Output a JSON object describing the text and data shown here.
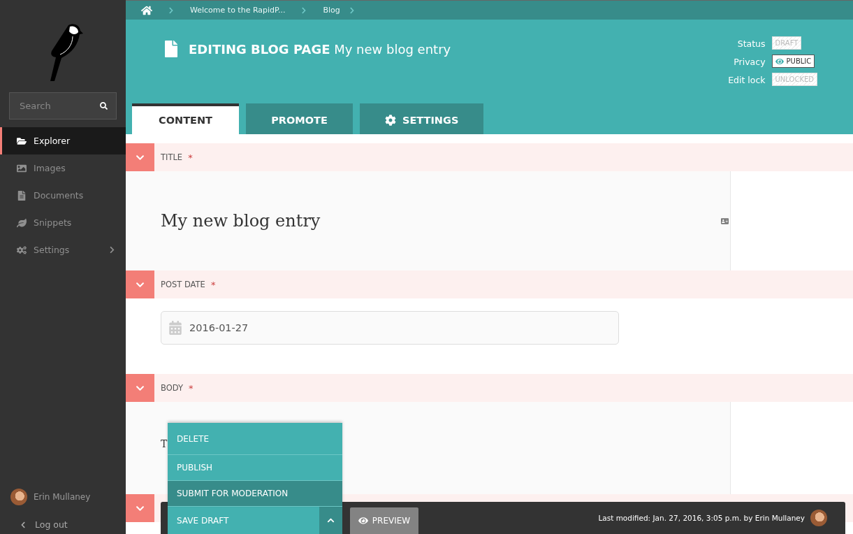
{
  "sidebar": {
    "search": {
      "placeholder": "Search"
    },
    "items": [
      {
        "label": "Explorer",
        "selected": true,
        "has_submenu": false
      },
      {
        "label": "Images",
        "selected": false,
        "has_submenu": false
      },
      {
        "label": "Documents",
        "selected": false,
        "has_submenu": false
      },
      {
        "label": "Snippets",
        "selected": false,
        "has_submenu": false
      },
      {
        "label": "Settings",
        "selected": false,
        "has_submenu": true
      }
    ],
    "user": {
      "name": "Erin Mullaney"
    },
    "logout": "Log out"
  },
  "breadcrumb": [
    "Welcome to the RapidP...",
    "Blog"
  ],
  "header": {
    "action": "EDITING BLOG PAGE",
    "page_title": "My new blog entry"
  },
  "meta": [
    {
      "label": "Status",
      "value": "DRAFT",
      "kind": "hatched"
    },
    {
      "label": "Privacy",
      "value": "PUBLIC",
      "kind": "public"
    },
    {
      "label": "Edit lock",
      "value": "UNLOCKED",
      "kind": "hatched"
    }
  ],
  "tabs": [
    {
      "label": "CONTENT",
      "selected": true,
      "kind": "plain"
    },
    {
      "label": "PROMOTE",
      "selected": false,
      "kind": "plain"
    },
    {
      "label": "SETTINGS",
      "selected": false,
      "kind": "settings"
    }
  ],
  "sections": [
    {
      "kind": "title",
      "label": "TITLE",
      "required_mark": "*",
      "value": "My new blog entry"
    },
    {
      "kind": "date",
      "label": "POST DATE",
      "required_mark": "*",
      "value": "2016-01-27"
    },
    {
      "kind": "body",
      "label": "BODY",
      "required_mark": "*",
      "value": "T"
    },
    {
      "kind": "collapsed"
    }
  ],
  "actions": {
    "menu": [
      {
        "label": "DELETE",
        "selected": false
      },
      {
        "label": "PUBLISH",
        "selected": false
      },
      {
        "label": "SUBMIT FOR MODERATION",
        "selected": true
      }
    ],
    "primary": "SAVE DRAFT",
    "preview": "PREVIEW"
  },
  "footer": {
    "last_modified": "Last modified: Jan. 27, 2016, 3:05 p.m. by Erin Mullaney"
  }
}
